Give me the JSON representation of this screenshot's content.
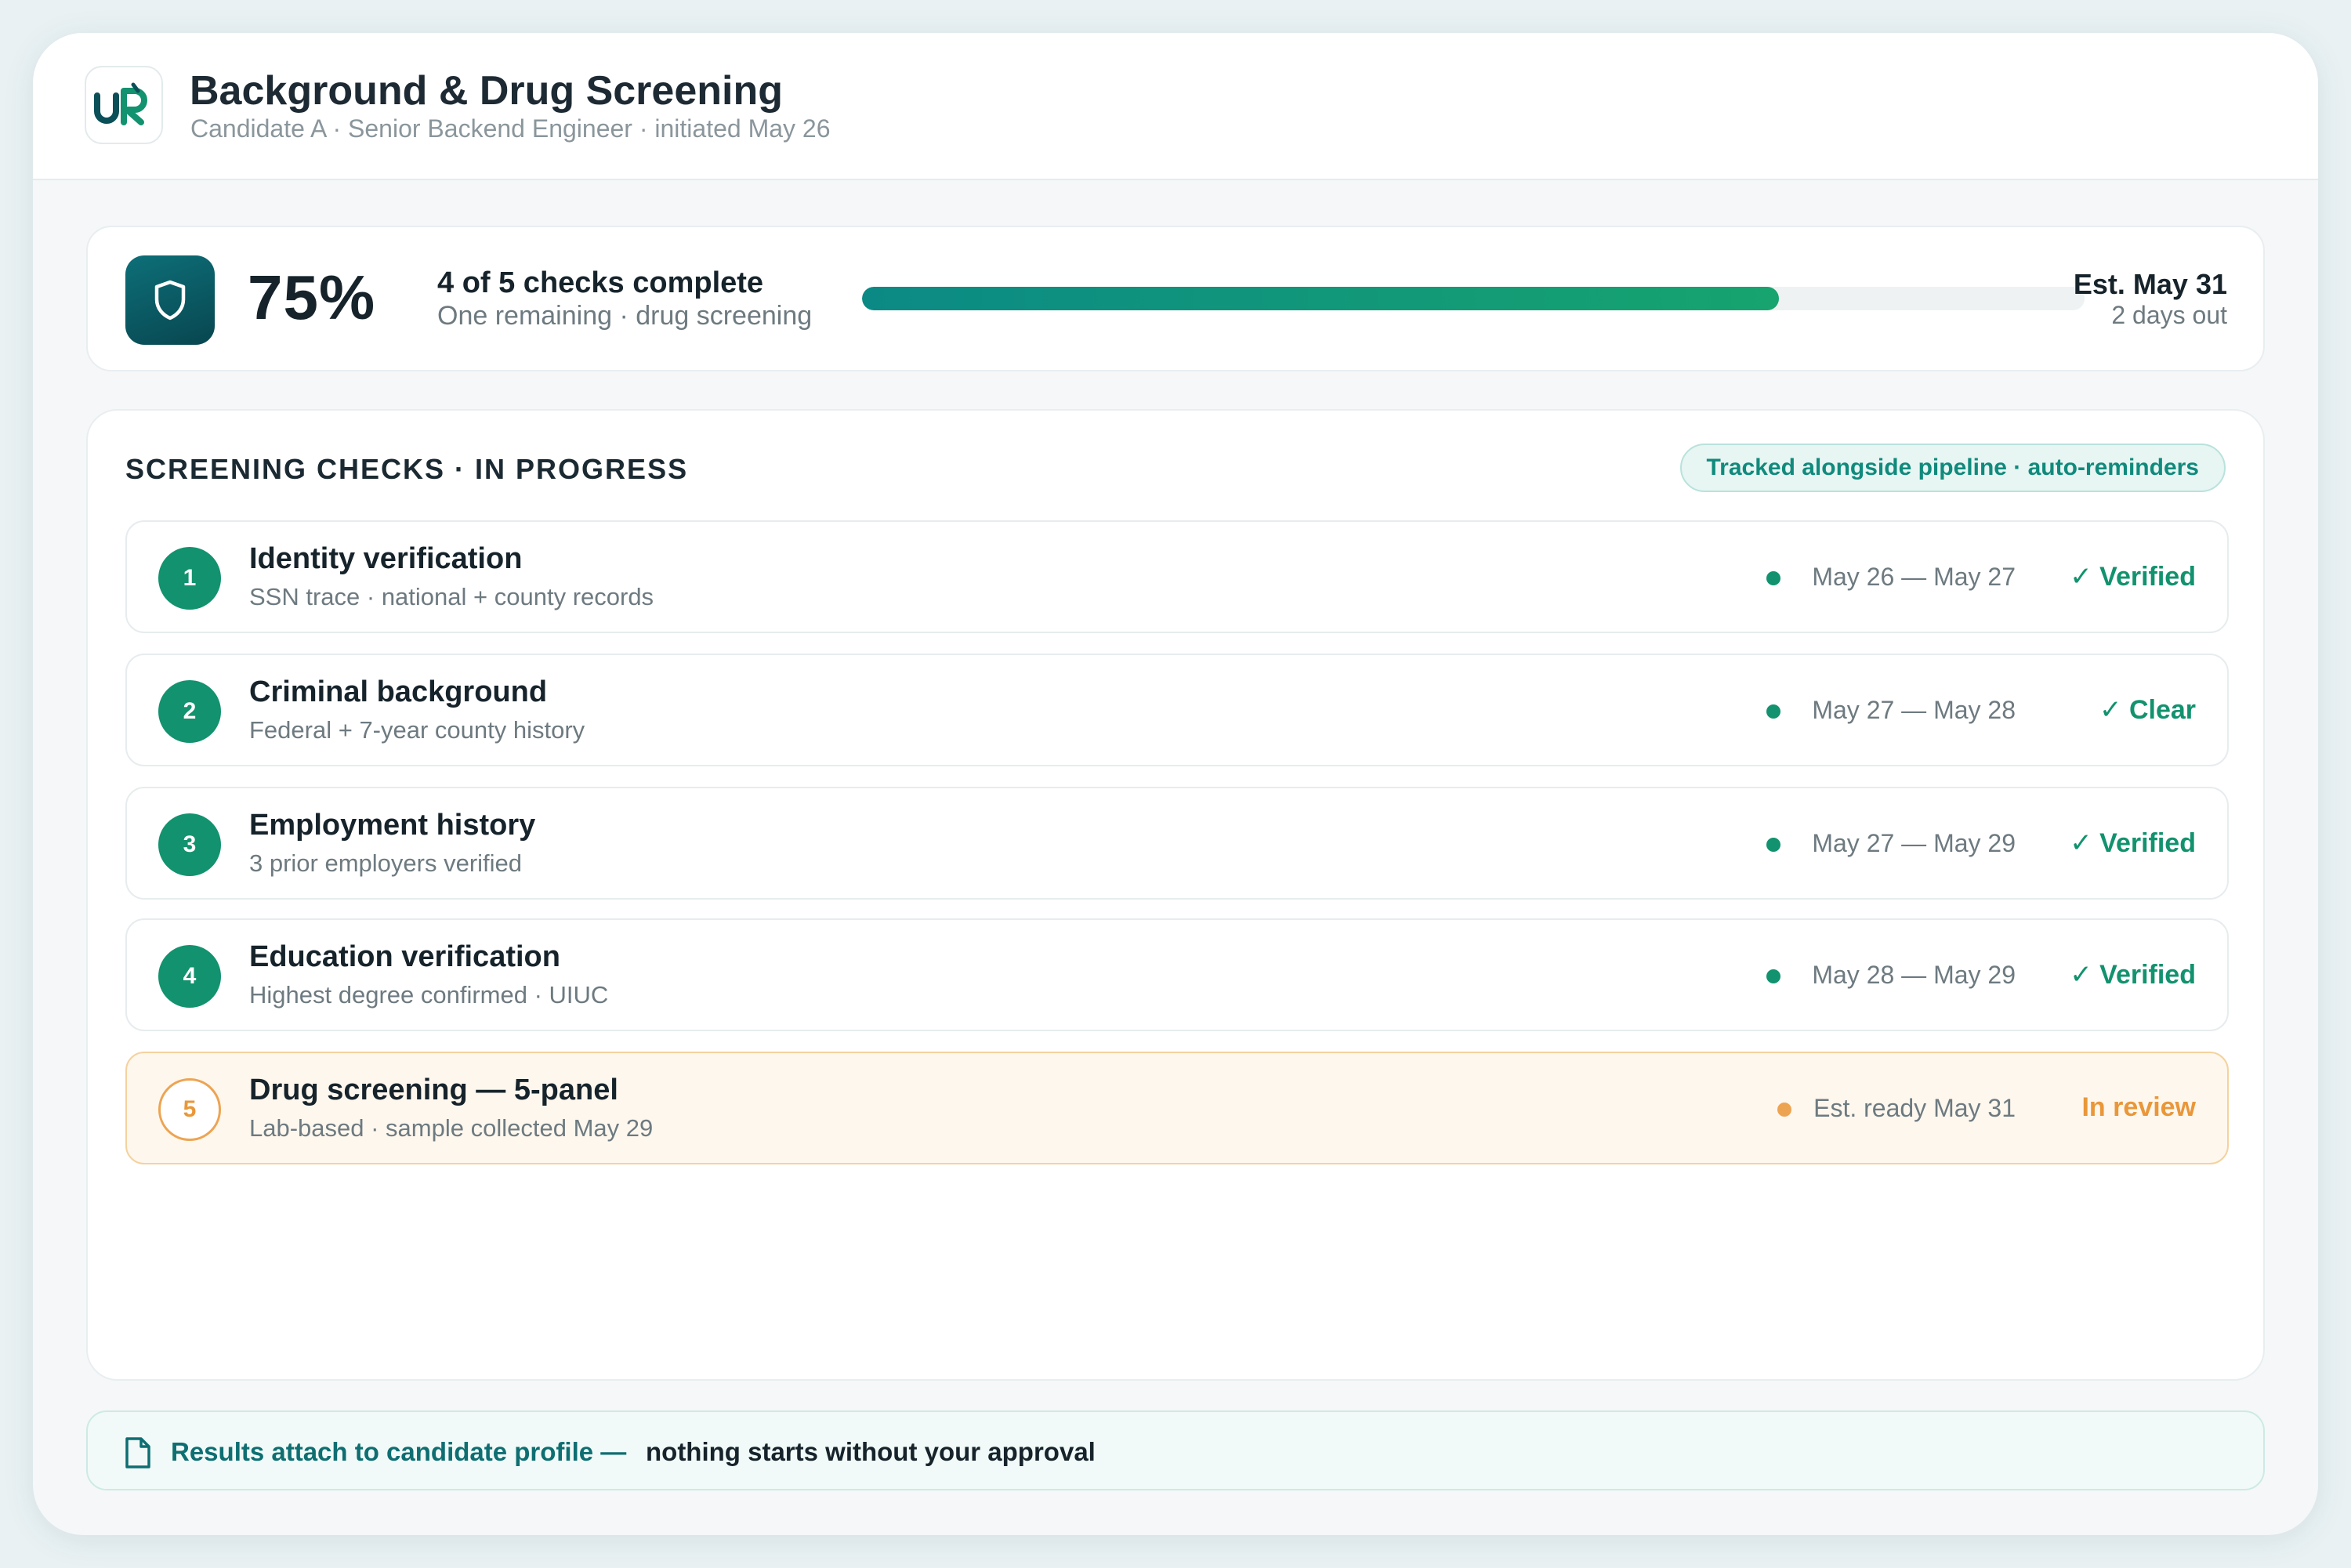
{
  "header": {
    "logo_text": "uR",
    "title": "Background & Drug Screening",
    "subtitle": "Candidate A · Senior Backend Engineer · initiated May 26"
  },
  "summary": {
    "icon": "shield-icon",
    "percent_label": "75%",
    "progress_fraction": 0.75,
    "title": "4 of 5 checks complete",
    "subtitle": "One remaining · drug screening",
    "est_date": "Est. May 31",
    "est_relative": "2 days out"
  },
  "checks": {
    "section_title": "SCREENING CHECKS · IN PROGRESS",
    "pill": "Tracked alongside pipeline · auto-reminders",
    "items": [
      {
        "number": "1",
        "title": "Identity verification",
        "subtitle": "SSN trace · national + county records",
        "dates": "May 26 — May 27",
        "status": "✓ Verified"
      },
      {
        "number": "2",
        "title": "Criminal background",
        "subtitle": "Federal + 7-year county history",
        "dates": "May 27 — May 28",
        "status": "✓ Clear"
      },
      {
        "number": "3",
        "title": "Employment history",
        "subtitle": "3 prior employers verified",
        "dates": "May 27 — May 29",
        "status": "✓ Verified"
      },
      {
        "number": "4",
        "title": "Education verification",
        "subtitle": "Highest degree confirmed · UIUC",
        "dates": "May 28 — May 29",
        "status": "✓ Verified"
      },
      {
        "number": "5",
        "title": "Drug screening — 5-panel",
        "subtitle": "Lab-based · sample collected May 29",
        "dates": "Est. ready May 31",
        "status": "In review"
      }
    ]
  },
  "footer": {
    "icon": "document-icon",
    "text_a": "Results attach to candidate profile —",
    "text_b": "nothing starts without your approval"
  },
  "colors": {
    "accent": "#12926e",
    "pending": "#e99739",
    "brand_dark": "#0b4f58"
  }
}
